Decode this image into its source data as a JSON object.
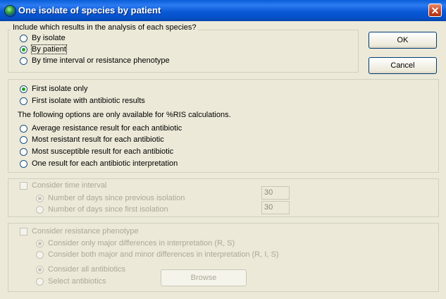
{
  "window": {
    "title": "One isolate of species by patient",
    "close_label": "✕"
  },
  "include_group": {
    "legend": "Include which results in the analysis of each species?",
    "options": [
      {
        "label": "By isolate",
        "selected": false
      },
      {
        "label": "By patient",
        "selected": true
      },
      {
        "label": "By time interval or resistance phenotype",
        "selected": false
      }
    ]
  },
  "buttons": {
    "ok": "OK",
    "cancel": "Cancel",
    "browse": "Browse"
  },
  "isolate_group": {
    "options": [
      {
        "label": "First isolate only",
        "selected": true
      },
      {
        "label": "First isolate with antibiotic results",
        "selected": false
      }
    ],
    "ris_note": "The following options are only available for %RIS calculations.",
    "ris_options": [
      {
        "label": "Average resistance result for each antibiotic",
        "selected": false
      },
      {
        "label": "Most resistant result for each antibiotic",
        "selected": false
      },
      {
        "label": "Most susceptible result for each antibiotic",
        "selected": false
      },
      {
        "label": "One result for each antibiotic interpretation",
        "selected": false
      }
    ]
  },
  "time_group": {
    "checkbox_label": "Consider time interval",
    "options": [
      {
        "label": "Number of days since previous isolation",
        "selected": true,
        "value": "30"
      },
      {
        "label": "Number of days since first isolation",
        "selected": false,
        "value": "30"
      }
    ]
  },
  "phenotype_group": {
    "checkbox_label": "Consider resistance phenotype",
    "difference_options": [
      {
        "label": "Consider only major differences in interpretation (R, S)",
        "selected": true
      },
      {
        "label": "Consider both major and minor differences in interpretation (R, I, S)",
        "selected": false
      }
    ],
    "antibiotic_options": [
      {
        "label": "Consider all antibiotics",
        "selected": true
      },
      {
        "label": "Select antibiotics",
        "selected": false
      }
    ]
  }
}
